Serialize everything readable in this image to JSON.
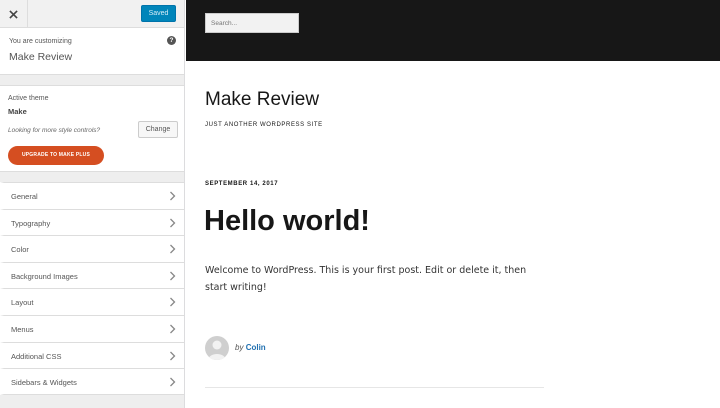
{
  "customizer": {
    "save_label": "Saved",
    "you_are_customizing": "You are customizing",
    "site_name": "Make Review",
    "active_theme_label": "Active theme",
    "theme_name": "Make",
    "more_controls": "Looking for more style controls?",
    "change_label": "Change",
    "upgrade_label": "UPGRADE TO MAKE PLUS",
    "panels": [
      {
        "label": "General"
      },
      {
        "label": "Typography"
      },
      {
        "label": "Color"
      },
      {
        "label": "Background Images"
      },
      {
        "label": "Layout"
      },
      {
        "label": "Menus"
      },
      {
        "label": "Additional CSS"
      },
      {
        "label": "Sidebars & Widgets"
      }
    ],
    "colors": {
      "accent": "#0085ba",
      "upgrade": "#d54e21"
    }
  },
  "preview": {
    "search_placeholder": "Search...",
    "site_title": "Make Review",
    "tagline": "Just another WordPress site",
    "post": {
      "date": "September 14, 2017",
      "title": "Hello world!",
      "body": "Welcome to WordPress. This is your first post. Edit or delete it, then start writing!",
      "by": "by",
      "author": "Colin"
    }
  }
}
